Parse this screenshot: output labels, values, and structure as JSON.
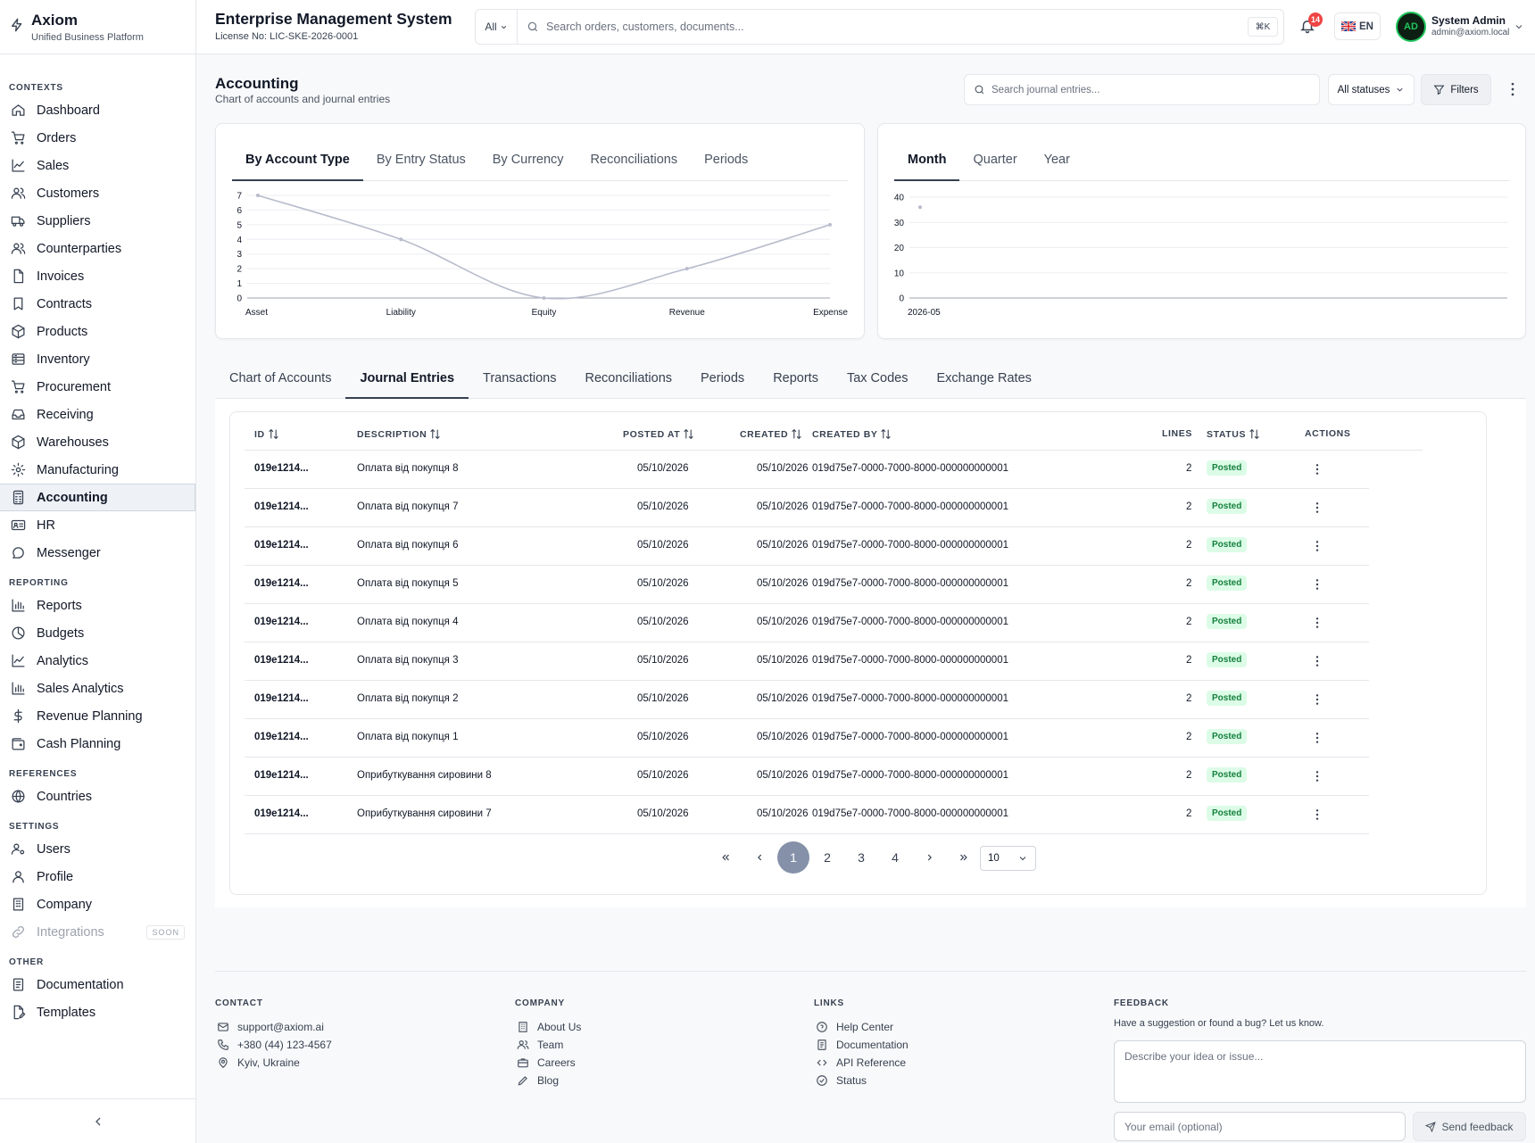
{
  "brand": {
    "name": "Axiom",
    "tagline": "Unified Business Platform"
  },
  "header": {
    "title": "Enterprise Management System",
    "license": "License No: LIC-SKE-2026-0001",
    "search_scope": "All",
    "search_placeholder": "Search orders, customers, documents...",
    "shortcut": "⌘K",
    "notifications": "14",
    "language": "EN",
    "user_name": "System Admin",
    "user_email": "admin@axiom.local",
    "avatar_text": "AD"
  },
  "sidebar": {
    "sections": [
      {
        "title": "CONTEXTS",
        "items": [
          {
            "label": "Dashboard",
            "icon": "home"
          },
          {
            "label": "Orders",
            "icon": "cart"
          },
          {
            "label": "Sales",
            "icon": "trend"
          },
          {
            "label": "Customers",
            "icon": "users"
          },
          {
            "label": "Suppliers",
            "icon": "truck"
          },
          {
            "label": "Counterparties",
            "icon": "users"
          },
          {
            "label": "Invoices",
            "icon": "file"
          },
          {
            "label": "Contracts",
            "icon": "bookmark"
          },
          {
            "label": "Products",
            "icon": "box"
          },
          {
            "label": "Inventory",
            "icon": "database"
          },
          {
            "label": "Procurement",
            "icon": "cart"
          },
          {
            "label": "Receiving",
            "icon": "inbox"
          },
          {
            "label": "Warehouses",
            "icon": "box"
          },
          {
            "label": "Manufacturing",
            "icon": "gear"
          },
          {
            "label": "Accounting",
            "icon": "calculator",
            "active": true
          },
          {
            "label": "HR",
            "icon": "idcard"
          },
          {
            "label": "Messenger",
            "icon": "chat"
          }
        ]
      },
      {
        "title": "REPORTING",
        "items": [
          {
            "label": "Reports",
            "icon": "barchart"
          },
          {
            "label": "Budgets",
            "icon": "pie"
          },
          {
            "label": "Analytics",
            "icon": "trend"
          },
          {
            "label": "Sales Analytics",
            "icon": "barchart"
          },
          {
            "label": "Revenue Planning",
            "icon": "dollar"
          },
          {
            "label": "Cash Planning",
            "icon": "wallet"
          }
        ]
      },
      {
        "title": "REFERENCES",
        "items": [
          {
            "label": "Countries",
            "icon": "globe"
          }
        ]
      },
      {
        "title": "SETTINGS",
        "items": [
          {
            "label": "Users",
            "icon": "usercog"
          },
          {
            "label": "Profile",
            "icon": "user"
          },
          {
            "label": "Company",
            "icon": "building"
          },
          {
            "label": "Integrations",
            "icon": "link",
            "disabled": true,
            "badge": "SOON"
          }
        ]
      },
      {
        "title": "OTHER",
        "items": [
          {
            "label": "Documentation",
            "icon": "book"
          },
          {
            "label": "Templates",
            "icon": "filepen"
          }
        ]
      }
    ]
  },
  "page": {
    "title": "Accounting",
    "subtitle": "Chart of accounts and journal entries",
    "search_placeholder": "Search journal entries...",
    "status_filter": "All statuses",
    "filters_label": "Filters"
  },
  "chart_tabs_left": [
    "By Account Type",
    "By Entry Status",
    "By Currency",
    "Reconciliations",
    "Periods"
  ],
  "chart_tabs_right": [
    "Month",
    "Quarter",
    "Year"
  ],
  "chart_data": [
    {
      "type": "line",
      "categories": [
        "Asset",
        "Liability",
        "Equity",
        "Revenue",
        "Expense"
      ],
      "values": [
        7,
        4,
        0,
        2,
        5
      ],
      "ylim": [
        0,
        7
      ],
      "yticks": [
        0,
        1,
        2,
        3,
        4,
        5,
        6,
        7
      ],
      "grid": true,
      "color": "#b8bccb"
    },
    {
      "type": "scatter",
      "categories": [
        "2026-05"
      ],
      "values": [
        36
      ],
      "ylim": [
        0,
        40
      ],
      "yticks": [
        0,
        10,
        20,
        30,
        40
      ],
      "grid": true,
      "color": "#b8bccb"
    }
  ],
  "main_tabs": [
    "Chart of Accounts",
    "Journal Entries",
    "Transactions",
    "Reconciliations",
    "Periods",
    "Reports",
    "Tax Codes",
    "Exchange Rates"
  ],
  "table": {
    "columns": [
      "ID",
      "DESCRIPTION",
      "POSTED AT",
      "CREATED",
      "CREATED BY",
      "LINES",
      "STATUS",
      "ACTIONS"
    ],
    "rows": [
      {
        "id": "019e1214...",
        "description": "Оплата від покупця 8",
        "posted_at": "05/10/2026",
        "created": "05/10/2026",
        "created_by": "019d75e7-0000-7000-8000-000000000001",
        "lines": "2",
        "status": "Posted"
      },
      {
        "id": "019e1214...",
        "description": "Оплата від покупця 7",
        "posted_at": "05/10/2026",
        "created": "05/10/2026",
        "created_by": "019d75e7-0000-7000-8000-000000000001",
        "lines": "2",
        "status": "Posted"
      },
      {
        "id": "019e1214...",
        "description": "Оплата від покупця 6",
        "posted_at": "05/10/2026",
        "created": "05/10/2026",
        "created_by": "019d75e7-0000-7000-8000-000000000001",
        "lines": "2",
        "status": "Posted"
      },
      {
        "id": "019e1214...",
        "description": "Оплата від покупця 5",
        "posted_at": "05/10/2026",
        "created": "05/10/2026",
        "created_by": "019d75e7-0000-7000-8000-000000000001",
        "lines": "2",
        "status": "Posted"
      },
      {
        "id": "019e1214...",
        "description": "Оплата від покупця 4",
        "posted_at": "05/10/2026",
        "created": "05/10/2026",
        "created_by": "019d75e7-0000-7000-8000-000000000001",
        "lines": "2",
        "status": "Posted"
      },
      {
        "id": "019e1214...",
        "description": "Оплата від покупця 3",
        "posted_at": "05/10/2026",
        "created": "05/10/2026",
        "created_by": "019d75e7-0000-7000-8000-000000000001",
        "lines": "2",
        "status": "Posted"
      },
      {
        "id": "019e1214...",
        "description": "Оплата від покупця 2",
        "posted_at": "05/10/2026",
        "created": "05/10/2026",
        "created_by": "019d75e7-0000-7000-8000-000000000001",
        "lines": "2",
        "status": "Posted"
      },
      {
        "id": "019e1214...",
        "description": "Оплата від покупця 1",
        "posted_at": "05/10/2026",
        "created": "05/10/2026",
        "created_by": "019d75e7-0000-7000-8000-000000000001",
        "lines": "2",
        "status": "Posted"
      },
      {
        "id": "019e1214...",
        "description": "Оприбуткування сировини 8",
        "posted_at": "05/10/2026",
        "created": "05/10/2026",
        "created_by": "019d75e7-0000-7000-8000-000000000001",
        "lines": "2",
        "status": "Posted"
      },
      {
        "id": "019e1214...",
        "description": "Оприбуткування сировини 7",
        "posted_at": "05/10/2026",
        "created": "05/10/2026",
        "created_by": "019d75e7-0000-7000-8000-000000000001",
        "lines": "2",
        "status": "Posted"
      }
    ]
  },
  "pagination": {
    "pages": [
      "1",
      "2",
      "3",
      "4"
    ],
    "current": "1",
    "page_size": "10"
  },
  "footer": {
    "contact": {
      "title": "CONTACT",
      "email": "support@axiom.ai",
      "phone": "+380 (44) 123-4567",
      "location": "Kyiv, Ukraine"
    },
    "company": {
      "title": "COMPANY",
      "links": [
        "About Us",
        "Team",
        "Careers",
        "Blog"
      ]
    },
    "links": {
      "title": "LINKS",
      "links": [
        "Help Center",
        "Documentation",
        "API Reference",
        "Status"
      ]
    },
    "feedback": {
      "title": "FEEDBACK",
      "text": "Have a suggestion or found a bug? Let us know.",
      "placeholder": "Describe your idea or issue...",
      "email_placeholder": "Your email (optional)",
      "send_label": "Send feedback"
    }
  }
}
